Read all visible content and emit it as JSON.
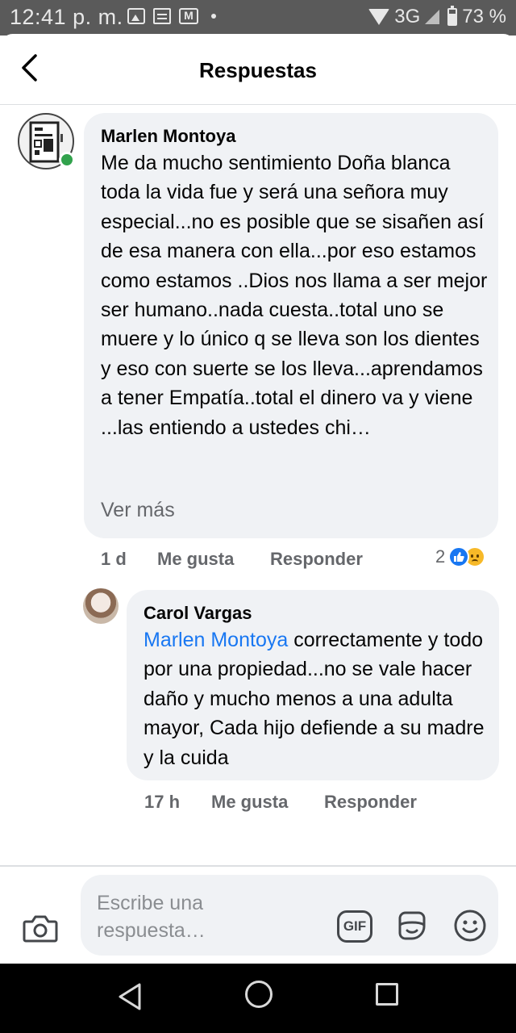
{
  "status_bar": {
    "time": "12:41 p. m.",
    "network": "3G",
    "battery": "73 %",
    "icons": [
      "image-icon",
      "news-icon",
      "gmail-icon",
      "dot-icon",
      "wifi-icon",
      "signal-icon",
      "battery-icon"
    ]
  },
  "header": {
    "title": "Respuestas",
    "back_icon": "chevron-left-icon"
  },
  "comment": {
    "author": "Marlen Montoya",
    "text": "Me da mucho sentimiento Doña blanca toda la vida fue y será una señora muy especial...no es posible que se sisañen así de esa manera con ella...por eso estamos como estamos ..Dios nos llama a ser mejor ser humano..nada cuesta..total uno se muere y lo único q se lleva son los dientes y eso con suerte se los lleva...aprendamos a tener Empatía..total el dinero va y viene ...las entiendo a ustedes chi…",
    "see_more": "Ver más",
    "time": "1 d",
    "like": "Me gusta",
    "reply": "Responder",
    "reaction_count": "2",
    "reaction_icons": [
      "like-reaction-icon",
      "sad-reaction-icon"
    ],
    "online": true
  },
  "reply": {
    "author": "Carol Vargas",
    "mention": "Marlen Montoya",
    "text": " correctamente y todo por una propiedad...no se vale hacer daño y mucho menos a una adulta mayor, Cada hijo defiende a su madre y la cuida",
    "time": "17 h",
    "like": "Me gusta",
    "reply": "Responder"
  },
  "composer": {
    "placeholder": "Escribe una respuesta…",
    "gif_label": "GIF",
    "icons": [
      "camera-icon",
      "gif-icon",
      "sticker-icon",
      "emoji-icon"
    ]
  },
  "nav": {
    "icons": [
      "nav-back-icon",
      "nav-home-icon",
      "nav-recents-icon"
    ]
  },
  "colors": {
    "accent": "#1877f2",
    "bubble": "#f0f2f5",
    "secondary_text": "#65676b",
    "online": "#31a24c",
    "status_bar": "#5a5a5a"
  }
}
